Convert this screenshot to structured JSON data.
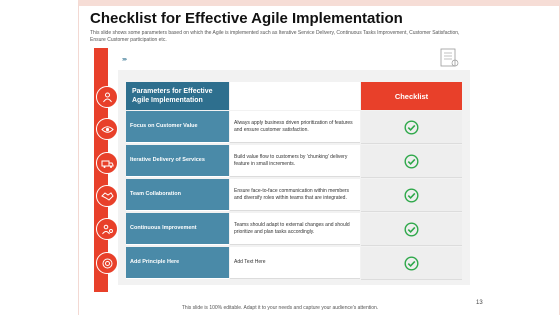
{
  "slide": {
    "title": "Checklist for Effective Agile Implementation",
    "description": "This slide shows some parameters based on which the Agile is implemented such as Iterative Service Delivery, Continuous Tasks Improvement, Customer Satisfaction, Ensure Customer participation etc.",
    "chevrons": "››››",
    "footer": "This slide is 100% editable. Adapt it to your needs and capture your audience's attention.",
    "page_number": "13"
  },
  "table": {
    "header_param": "Parameters for Effective Agile Implementation",
    "header_check": "Checklist",
    "rows": [
      {
        "param": "Focus on Customer Value",
        "desc": "Always apply business driven prioritization of features and ensure customer satisfaction.",
        "icon": "team-icon",
        "checked": true
      },
      {
        "param": "Iterative Delivery of Services",
        "desc": "Build value flow to customers by 'chunking' delivery feature in small increments.",
        "icon": "eye-icon",
        "checked": true
      },
      {
        "param": "Team Collaboration",
        "desc": "Ensure face-to-face communication within members and diversify roles within teams that are integrated.",
        "icon": "delivery-truck-icon",
        "checked": true
      },
      {
        "param": "Continuous Improvement",
        "desc": "Teams should adapt to external changes and should prioritize and plan tasks accordingly.",
        "icon": "handshake-icon",
        "checked": true
      },
      {
        "param": "Add Principle Here",
        "desc": "Add Text Here",
        "icon": "gear-target-icon",
        "checked": true
      }
    ]
  },
  "colors": {
    "accent_red": "#e8402a",
    "teal_dark": "#2e6f8e",
    "teal": "#4a8aa8",
    "check_green": "#2ea84a"
  }
}
